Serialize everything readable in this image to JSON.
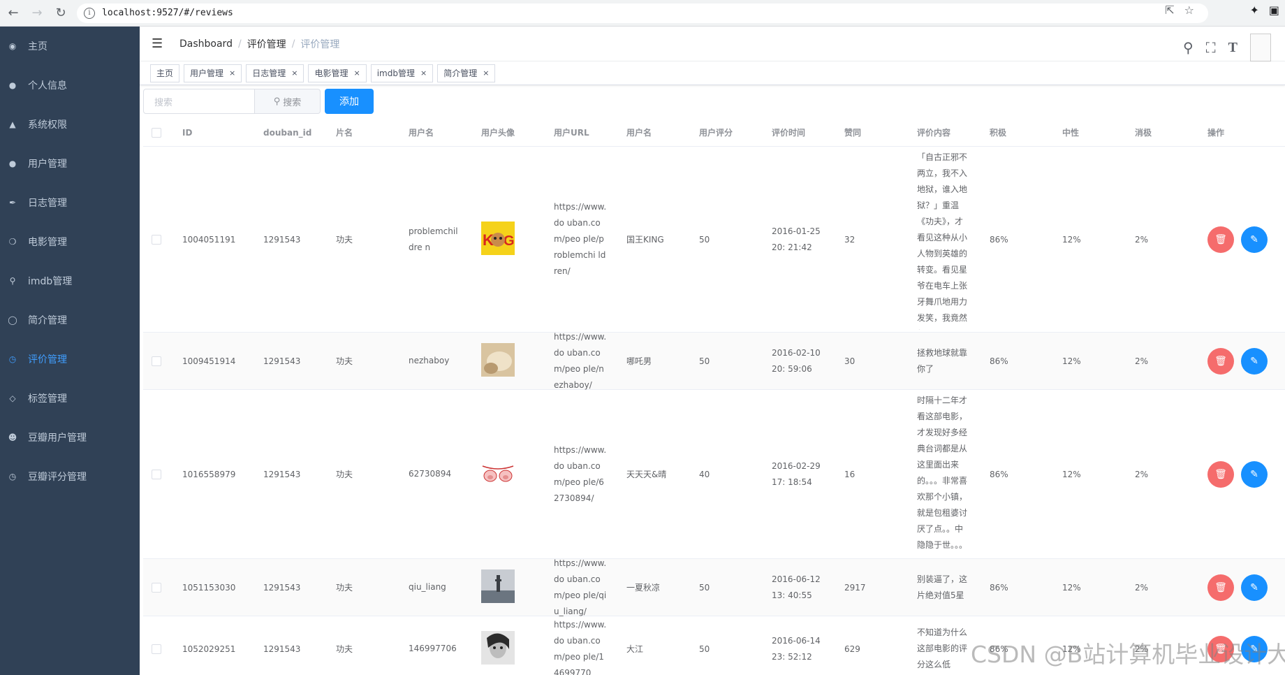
{
  "browser": {
    "url": "localhost:9527/#/reviews"
  },
  "sidebar": {
    "items": [
      {
        "label": "主页",
        "icon": "dashboard-icon"
      },
      {
        "label": "个人信息",
        "icon": "user-icon"
      },
      {
        "label": "系统权限",
        "icon": "permission-icon"
      },
      {
        "label": "用户管理",
        "icon": "users-icon"
      },
      {
        "label": "日志管理",
        "icon": "feather-icon"
      },
      {
        "label": "电影管理",
        "icon": "film-icon"
      },
      {
        "label": "imdb管理",
        "icon": "key-icon"
      },
      {
        "label": "简介管理",
        "icon": "compass-icon"
      },
      {
        "label": "评价管理",
        "icon": "clock-icon",
        "active": true
      },
      {
        "label": "标签管理",
        "icon": "tag-icon"
      },
      {
        "label": "豆瓣用户管理",
        "icon": "person-icon"
      },
      {
        "label": "豆瓣评分管理",
        "icon": "clock-icon"
      }
    ]
  },
  "breadcrumb": [
    "Dashboard",
    "评价管理",
    "评价管理"
  ],
  "tags": [
    {
      "label": "主页",
      "closable": false
    },
    {
      "label": "用户管理",
      "closable": true
    },
    {
      "label": "日志管理",
      "closable": true
    },
    {
      "label": "电影管理",
      "closable": true
    },
    {
      "label": "imdb管理",
      "closable": true
    },
    {
      "label": "简介管理",
      "closable": true
    }
  ],
  "filter": {
    "search_placeholder": "搜索",
    "search_button": "搜索",
    "add_button": "添加"
  },
  "table": {
    "headers": [
      "ID",
      "douban_id",
      "片名",
      "用户名",
      "用户头像",
      "用户URL",
      "用户名",
      "用户评分",
      "评价时间",
      "赞同",
      "评价内容",
      "积极",
      "中性",
      "消极",
      "操作"
    ],
    "rows": [
      {
        "id": "1004051191",
        "douban_id": "1291543",
        "title": "功夫",
        "username": "problemchildre n",
        "avatar": "avatar-kng",
        "url": "https://www.do uban.com/peo ple/problemchi ldren/",
        "nickname": "国王KING",
        "score": "50",
        "time": "2016-01-25 20: 21:42",
        "votes": "32",
        "content": "「自古正邪不两立，我不入地狱，谁入地狱？」重温《功夫》，才看见这种从小人物到英雄的转变。看见星爷在电车上张牙舞爪地用力发笑，我竟然想哭。",
        "pos": "86%",
        "neu": "12%",
        "neg": "2%"
      },
      {
        "id": "1009451914",
        "douban_id": "1291543",
        "title": "功夫",
        "username": "nezhaboy",
        "avatar": "avatar-blur",
        "url": "https://www.do uban.com/peo ple/nezhaboy/",
        "nickname": "哪吒男",
        "score": "50",
        "time": "2016-02-10 20: 59:06",
        "votes": "30",
        "content": "拯救地球就靠你了",
        "pos": "86%",
        "neu": "12%",
        "neg": "2%"
      },
      {
        "id": "1016558979",
        "douban_id": "1291543",
        "title": "功夫",
        "username": "62730894",
        "avatar": "avatar-pigs",
        "url": "https://www.do uban.com/peo ple/62730894/",
        "nickname": "天天天&晴",
        "score": "40",
        "time": "2016-02-29 17: 18:54",
        "votes": "16",
        "content": "时隔十二年才看这部电影，才发现好多经典台词都是从这里面出来的。。。非常喜欢那个小镇，就是包租婆讨厌了点。。中隐隐于世。。。能力越大，责任越大",
        "pos": "86%",
        "neu": "12%",
        "neg": "2%"
      },
      {
        "id": "1051153030",
        "douban_id": "1291543",
        "title": "功夫",
        "username": "qiu_liang",
        "avatar": "avatar-tower",
        "url": "https://www.do uban.com/peo ple/qiu_liang/",
        "nickname": "一夏秋凉",
        "score": "50",
        "time": "2016-06-12 13: 40:55",
        "votes": "2917",
        "content": "别装逼了，这片绝对值5星",
        "pos": "86%",
        "neu": "12%",
        "neg": "2%"
      },
      {
        "id": "1052029251",
        "douban_id": "1291543",
        "title": "功夫",
        "username": "146997706",
        "avatar": "avatar-face",
        "url": "https://www.do uban.com/peo ple/14699770",
        "nickname": "大江",
        "score": "50",
        "time": "2016-06-14 23: 52:12",
        "votes": "629",
        "content": "不知道为什么这部电影的评分这么低",
        "pos": "86%",
        "neu": "12%",
        "neg": "2%"
      }
    ]
  },
  "watermark": "CSDN @B站计算机毕业设计大学"
}
